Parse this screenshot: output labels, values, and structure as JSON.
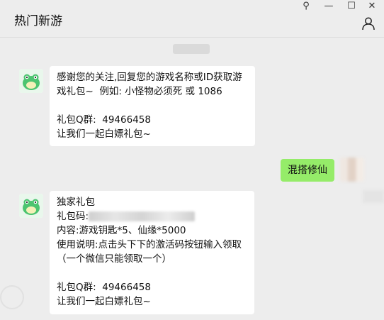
{
  "window": {
    "title": "热门新游",
    "controls": {
      "pin": "⚲",
      "minimize": "—",
      "maximize": "☐",
      "close": "✕"
    }
  },
  "messages": [
    {
      "from": "official",
      "lines": [
        "感谢您的关注,回复您的游戏名称或ID获取游",
        "戏礼包~  例如: 小怪物必须死 或 1086",
        "",
        "礼包Q群:  49466458",
        "让我们一起白嫖礼包~"
      ]
    },
    {
      "from": "user",
      "text": "混搭修仙"
    },
    {
      "from": "official",
      "lines": [
        "独家礼包",
        "礼包码:",
        "内容:游戏钥匙*5、仙缘*5000",
        "使用说明:点击头下下的激活码按钮输入领取",
        "（一个微信只能领取一个）",
        "",
        "礼包Q群:  49466458",
        "让我们一起白嫖礼包~"
      ]
    }
  ],
  "icons": {
    "user": "user-icon",
    "avatar": "green-frog-avatar"
  },
  "colors": {
    "background": "#ededed",
    "bubble_in": "#ffffff",
    "bubble_out": "#95ec69",
    "avatar_green": "#4cc470"
  }
}
